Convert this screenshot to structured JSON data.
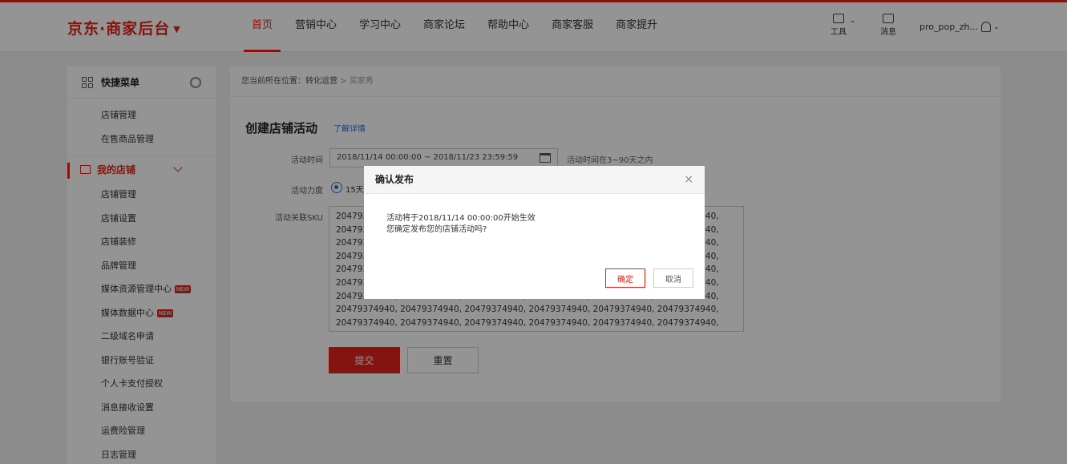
{
  "header": {
    "logo": "京东·商家后台",
    "nav": [
      "首页",
      "营销中心",
      "学习中心",
      "商家论坛",
      "帮助中心",
      "商家客服",
      "商家提升"
    ],
    "tools_label": "工具",
    "msg_label": "消息",
    "username": "pro_pop_zh..."
  },
  "sidebar": {
    "quick_title": "快捷菜单",
    "quick_items": [
      "店铺管理",
      "在售商品管理"
    ],
    "group_title": "我的店铺",
    "group_items": [
      "店铺管理",
      "店铺设置",
      "店铺装修",
      "品牌管理",
      "媒体资源管理中心",
      "媒体数据中心",
      "二级域名申请",
      "银行账号验证",
      "个人卡支付授权",
      "消息接收设置",
      "运费险管理",
      "日志管理"
    ]
  },
  "main": {
    "breadcrumb_prefix": "您当前所在位置：",
    "breadcrumb_mid": "转化运营",
    "breadcrumb_sep": " > ",
    "breadcrumb_last": "买家秀",
    "title": "创建店铺活动",
    "learn_link": "了解详情",
    "label_time": "活动时间",
    "time_value": "2018/11/14 00:00:00 ~ 2018/11/23 23:59:59",
    "time_hint": "活动时间在3~90天之内",
    "label_strength": "活动力度",
    "strength_value": "15天",
    "label_sku": "活动关联SKU",
    "sku_text": "20479374940, 20479374940, 20479374940, 20479374940, 20479374940, 20479374940, 20479374940, 20479374940, 20479374940, 20479374940, 20479374940, 20479374940, 20479374940, 20479374940, 20479374940, 20479374940, 20479374940, 20479374940, 20479374940, 20479374940, 20479374940, 20479374940, 20479374940, 20479374940, 20479374940, 20479374940, 20479374940, 20479374940, 20479374940, 20479374940, 20479374940, 20479374940, 20479374940, 20479374940, 20479374940, 20479374940, 20479374940, 20479374940, 20479374940, 20479374940, 20479374940, 20479374940, 20479374940, 20479374940, 20479374940, 20479374940, 20479374940, 20479374940, 20479374940, 20479374940, 20479374940, 20479374940, 20479374940, 20479374940, 20479374940, 20479374940, 20479374940",
    "submit": "提交",
    "reset": "重置"
  },
  "dialog": {
    "title": "确认发布",
    "close": "×",
    "line1": "活动将于2018/11/14 00:00:00开始生效",
    "line2": "您确定发布您的店铺活动吗?",
    "ok": "确定",
    "cancel": "取消"
  },
  "colors": {
    "accent": "#e2231a",
    "link": "#2f6fd6"
  }
}
